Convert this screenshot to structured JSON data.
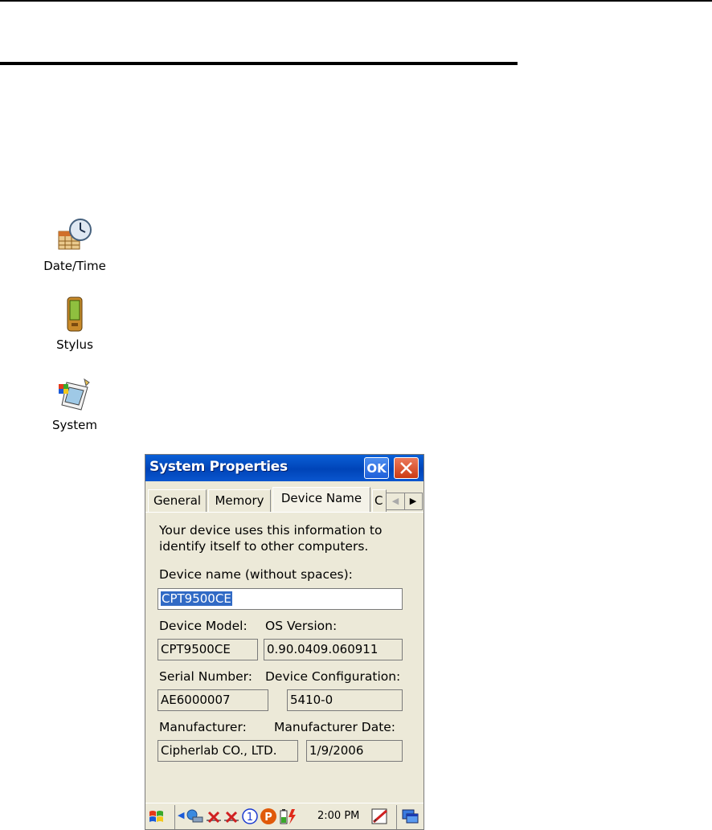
{
  "control_panel": {
    "items": [
      {
        "label": "Date/Time",
        "icon": "date-time-icon"
      },
      {
        "label": "Stylus",
        "icon": "stylus-icon"
      },
      {
        "label": "System",
        "icon": "system-icon"
      }
    ]
  },
  "dialog": {
    "title": "System Properties",
    "ok_label": "OK",
    "tabs": [
      {
        "label": "General",
        "active": false
      },
      {
        "label": "Memory",
        "active": false
      },
      {
        "label": "Device Name",
        "active": true
      },
      {
        "label": "C",
        "active": false
      }
    ],
    "intro_line1": "Your device uses this information to",
    "intro_line2": "identify itself to other computers.",
    "device_name_label": "Device name (without spaces):",
    "device_name_value": "CPT9500CE",
    "device_model_label": "Device Model:",
    "device_model_value": "CPT9500CE",
    "os_version_label": "OS Version:",
    "os_version_value": "0.90.0409.060911",
    "serial_label": "Serial Number:",
    "serial_value": "AE6000007",
    "config_label": "Device Configuration:",
    "config_value": "5410-0",
    "manufacturer_label": "Manufacturer:",
    "manufacturer_value": "Cipherlab CO., LTD.",
    "manufacturer_date_label": "Manufacturer Date:",
    "manufacturer_date_value": "1/9/2006"
  },
  "taskbar": {
    "clock": "2:00 PM"
  },
  "colors": {
    "titlebar": "#0044b8",
    "dialog_bg": "#ece9d8",
    "selection": "#316ac5",
    "close_button": "#cc3a14"
  }
}
